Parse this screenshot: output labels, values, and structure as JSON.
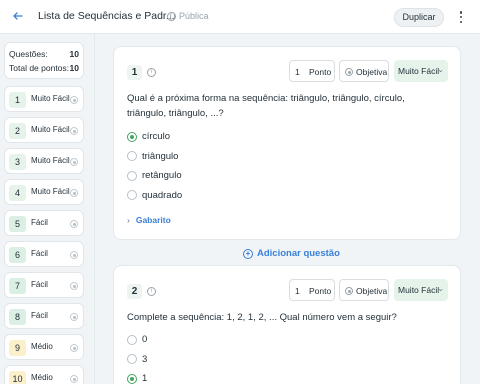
{
  "header": {
    "back_icon": "arrow-left-icon",
    "title": "Lista de Sequências e Padr...",
    "visibility": "Pública",
    "duplicate_label": "Duplicar"
  },
  "sidebar": {
    "stats": [
      {
        "label": "Questões:",
        "value": "10"
      },
      {
        "label": "Total de pontos:",
        "value": "10"
      }
    ],
    "items": [
      {
        "num": "1",
        "difficulty": "Muito Fácil",
        "color": "#e6f3ea"
      },
      {
        "num": "2",
        "difficulty": "Muito Fácil",
        "color": "#e6f3ea"
      },
      {
        "num": "3",
        "difficulty": "Muito Fácil",
        "color": "#e6f3ea"
      },
      {
        "num": "4",
        "difficulty": "Muito Fácil",
        "color": "#e6f3ea"
      },
      {
        "num": "5",
        "difficulty": "Fácil",
        "color": "#dcefe4"
      },
      {
        "num": "6",
        "difficulty": "Fácil",
        "color": "#dcefe4"
      },
      {
        "num": "7",
        "difficulty": "Fácil",
        "color": "#dcefe4"
      },
      {
        "num": "8",
        "difficulty": "Fácil",
        "color": "#dcefe4"
      },
      {
        "num": "9",
        "difficulty": "Médio",
        "color": "#fbf0c9"
      },
      {
        "num": "10",
        "difficulty": "Médio",
        "color": "#fbf0c9"
      }
    ]
  },
  "questions": [
    {
      "number": "1",
      "points_value": "1",
      "points_label": "Ponto",
      "type": "Objetiva",
      "difficulty": "Muito Fácil",
      "line1": "Qual é a próxima forma na sequência: triângulo, triângulo, círculo,",
      "line2": "triângulo, triângulo, ...?",
      "options": [
        {
          "text": "círculo",
          "selected": true
        },
        {
          "text": "triângulo",
          "selected": false
        },
        {
          "text": "retângulo",
          "selected": false
        },
        {
          "text": "quadrado",
          "selected": false
        }
      ],
      "answer_key_label": "Gabarito"
    },
    {
      "number": "2",
      "points_value": "1",
      "points_label": "Ponto",
      "type": "Objetiva",
      "difficulty": "Muito Fácil",
      "line1": "Complete a sequência: 1, 2, 1, 2, ... Qual número vem a seguir?",
      "options": [
        {
          "text": "0",
          "selected": false
        },
        {
          "text": "3",
          "selected": false
        },
        {
          "text": "1",
          "selected": true
        }
      ]
    }
  ],
  "add_question_label": "Adicionar questão",
  "colors": {
    "accent": "#3a7fd8",
    "selected": "#46a564",
    "difficulty_bg": "#e6f3ea"
  }
}
